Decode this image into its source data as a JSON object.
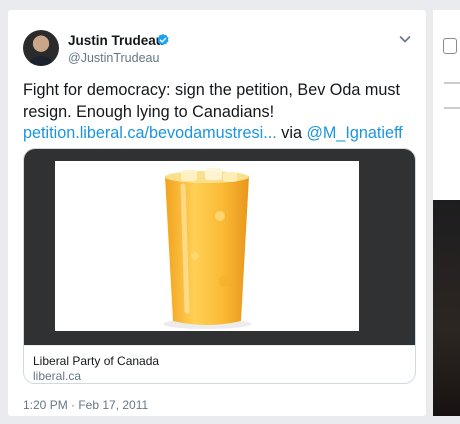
{
  "tweet": {
    "author_name": "Justin Trudeau",
    "author_handle": "@JustinTrudeau",
    "verified": true,
    "text_main": "Fight for democracy: sign the petition, Bev Oda must resign. Enough lying to Canadians!",
    "link_text": "petition.liberal.ca/bevodamustresi...",
    "via_text": "via",
    "mention": "@M_Ignatieff",
    "timestamp": "1:20 PM · Feb 17, 2011"
  },
  "link_card": {
    "title": "Liberal Party of Canada",
    "domain": "liberal.ca",
    "image_icon": "glass-of-orange-juice"
  },
  "colors": {
    "link": "#1b95e0",
    "verified": "#1da1f2",
    "text": "#14171a",
    "secondary": "#657786",
    "media_bg": "#2f3133"
  },
  "icons": {
    "menu": "chevron-down-icon",
    "verified": "verified-badge-icon"
  }
}
